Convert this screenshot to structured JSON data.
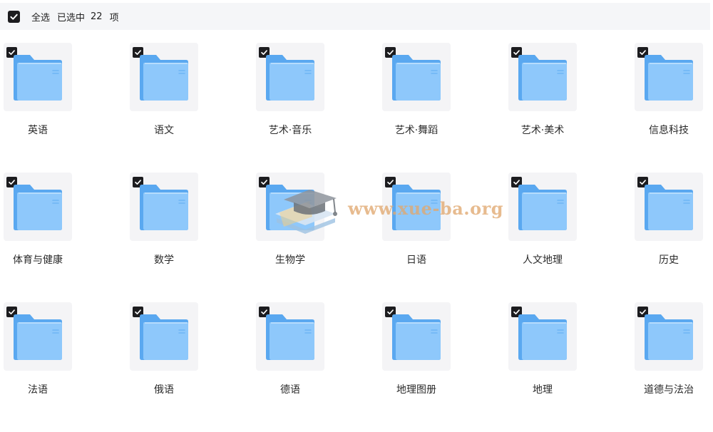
{
  "toolbar": {
    "select_all_label": "全选",
    "selected_prefix": "已选中",
    "selected_count": "22",
    "selected_suffix": "项"
  },
  "folders": [
    {
      "label": "英语"
    },
    {
      "label": "语文"
    },
    {
      "label": "艺术·音乐"
    },
    {
      "label": "艺术·舞蹈"
    },
    {
      "label": "艺术·美术"
    },
    {
      "label": "信息科技"
    },
    {
      "label": "体育与健康"
    },
    {
      "label": "数学"
    },
    {
      "label": "生物学"
    },
    {
      "label": "日语"
    },
    {
      "label": "人文地理"
    },
    {
      "label": "历史"
    },
    {
      "label": "法语"
    },
    {
      "label": "俄语"
    },
    {
      "label": "德语"
    },
    {
      "label": "地理图册"
    },
    {
      "label": "地理"
    },
    {
      "label": "道德与法治"
    }
  ],
  "watermark": {
    "text": "www.xue-ba.org"
  },
  "colors": {
    "checkbox": "#1c1c1f",
    "folder_back": "#5aa8f0",
    "folder_front": "#8ec8fb",
    "toolbar_bg": "#f5f6f8",
    "thumb_bg": "#f4f4f6",
    "watermark": "#e0a870"
  }
}
